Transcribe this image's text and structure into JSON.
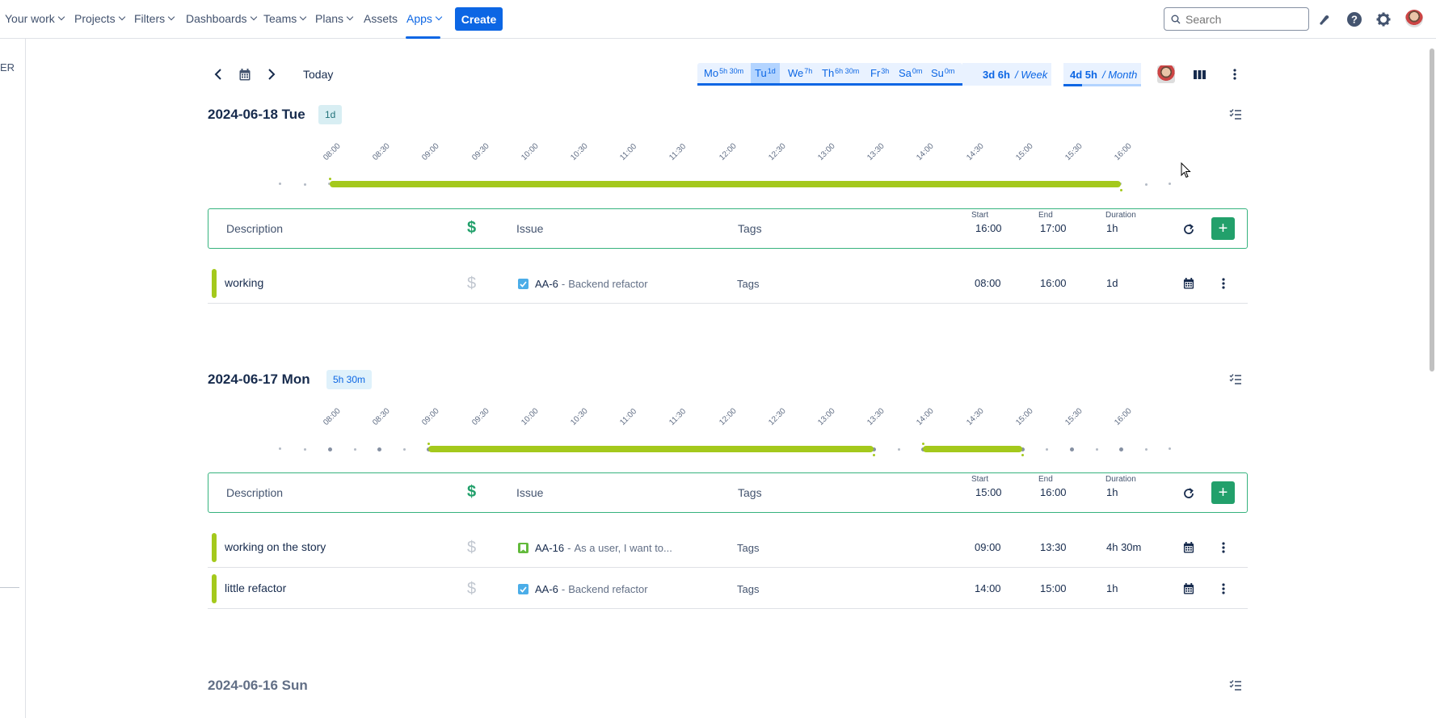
{
  "nav": {
    "items": [
      {
        "label": "Your work"
      },
      {
        "label": "Projects"
      },
      {
        "label": "Filters"
      },
      {
        "label": "Dashboards"
      },
      {
        "label": "Teams"
      },
      {
        "label": "Plans"
      },
      {
        "label": "Assets"
      },
      {
        "label": "Apps"
      }
    ],
    "create_label": "Create",
    "search_placeholder": "Search",
    "accent_color": "#0c66e4"
  },
  "sidebar": {
    "partial_text": "ER"
  },
  "toolbar": {
    "today_label": "Today",
    "days": [
      {
        "label": "Mo",
        "sup": "5h 30m"
      },
      {
        "label": "Tu",
        "sup": "1d"
      },
      {
        "label": "We",
        "sup": "7h"
      },
      {
        "label": "Th",
        "sup": "6h 30m"
      },
      {
        "label": "Fr",
        "sup": "3h"
      },
      {
        "label": "Sa",
        "sup": "0m"
      },
      {
        "label": "Su",
        "sup": "0m"
      }
    ],
    "week_total": "3d 6h",
    "week_label": "/ Week",
    "month_total": "4d 5h",
    "month_label": "/ Month",
    "month_progress": 0.24
  },
  "form": {
    "description_label": "Description",
    "issue_label": "Issue",
    "tags_label": "Tags",
    "start_label": "Start",
    "end_label": "End",
    "duration_label": "Duration"
  },
  "timeline_ticks": [
    "08:00",
    "08:30",
    "09:00",
    "09:30",
    "10:00",
    "10:30",
    "11:00",
    "11:30",
    "12:00",
    "12:30",
    "13:00",
    "13:30",
    "14:00",
    "14:30",
    "15:00",
    "15:30",
    "16:00"
  ],
  "days": [
    {
      "title": "2024-06-18 Tue",
      "badge": "1d",
      "form_start": "16:00",
      "form_end": "17:00",
      "form_duration": "1h",
      "blocks": [
        {
          "start": "08:00",
          "end": "16:00"
        }
      ],
      "entries": [
        {
          "description": "working",
          "issue_key": "AA-6",
          "issue_sep": "-",
          "issue_summary": "Backend refactor",
          "issue_type": "task",
          "tags": "Tags",
          "start": "08:00",
          "end": "16:00",
          "duration": "1d"
        }
      ]
    },
    {
      "title": "2024-06-17 Mon",
      "badge": "5h 30m",
      "form_start": "15:00",
      "form_end": "16:00",
      "form_duration": "1h",
      "blocks": [
        {
          "start": "09:00",
          "end": "13:30"
        },
        {
          "start": "14:00",
          "end": "15:00"
        }
      ],
      "entries": [
        {
          "description": "working on the story",
          "issue_key": "AA-16",
          "issue_sep": "-",
          "issue_summary": "As a user, I want to...",
          "issue_type": "story",
          "tags": "Tags",
          "start": "09:00",
          "end": "13:30",
          "duration": "4h 30m"
        },
        {
          "description": "little refactor",
          "issue_key": "AA-6",
          "issue_sep": "-",
          "issue_summary": "Backend refactor",
          "issue_type": "task",
          "tags": "Tags",
          "start": "14:00",
          "end": "15:00",
          "duration": "1h"
        }
      ]
    },
    {
      "title": "2024-06-16 Sun"
    }
  ]
}
